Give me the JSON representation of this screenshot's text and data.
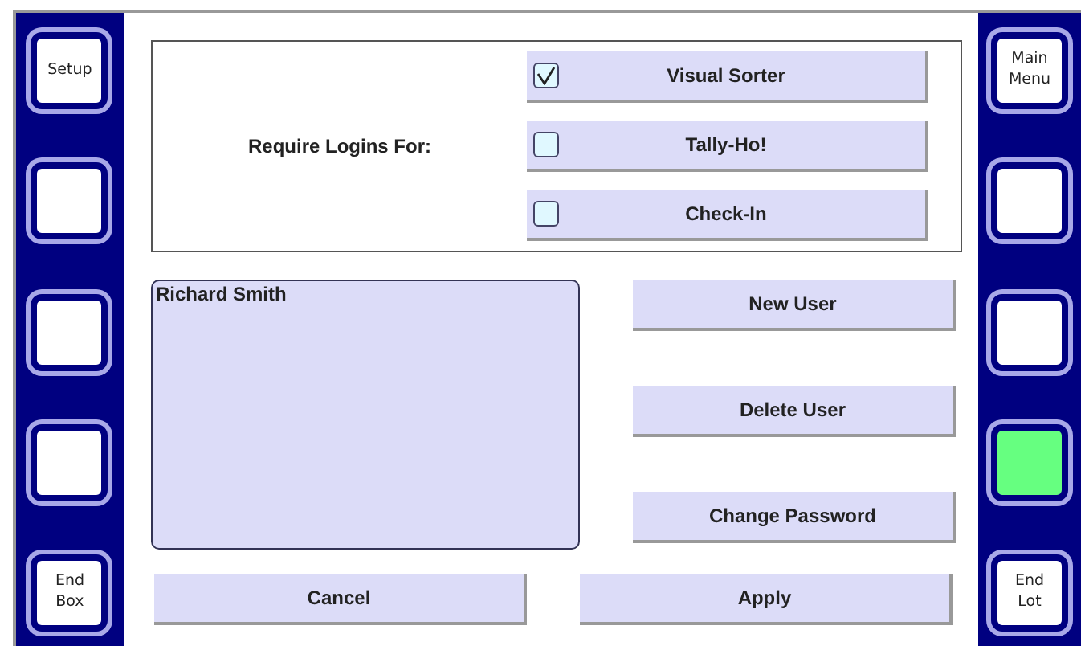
{
  "left_keys": [
    {
      "label": "Setup",
      "color": "#ffffff"
    },
    {
      "color": "#ffffff"
    },
    {
      "color": "#ffffff"
    },
    {
      "color": "#ffffff"
    },
    {
      "label": "End\nBox",
      "color": "#ffffff"
    }
  ],
  "require_logins": {
    "label": "Require Logins For:",
    "options": [
      {
        "label": "Visual Sorter",
        "checked": true
      },
      {
        "label": "Tally-Ho!",
        "checked": false
      },
      {
        "label": "Check-In",
        "checked": false
      }
    ]
  },
  "users": [
    "Richard Smith"
  ],
  "user_buttons": [
    "New User",
    "Delete User",
    "Change Password"
  ],
  "bottom_buttons": [
    "Cancel",
    "Apply"
  ],
  "right_keys": [
    {
      "label": "Main\nMenu",
      "color": "#ffffff"
    },
    {
      "color": "#ffffff"
    },
    {
      "color": "#ffffff"
    },
    {
      "color": "#66ff80"
    },
    {
      "label": "End\nLot",
      "color": "#ffffff"
    }
  ]
}
